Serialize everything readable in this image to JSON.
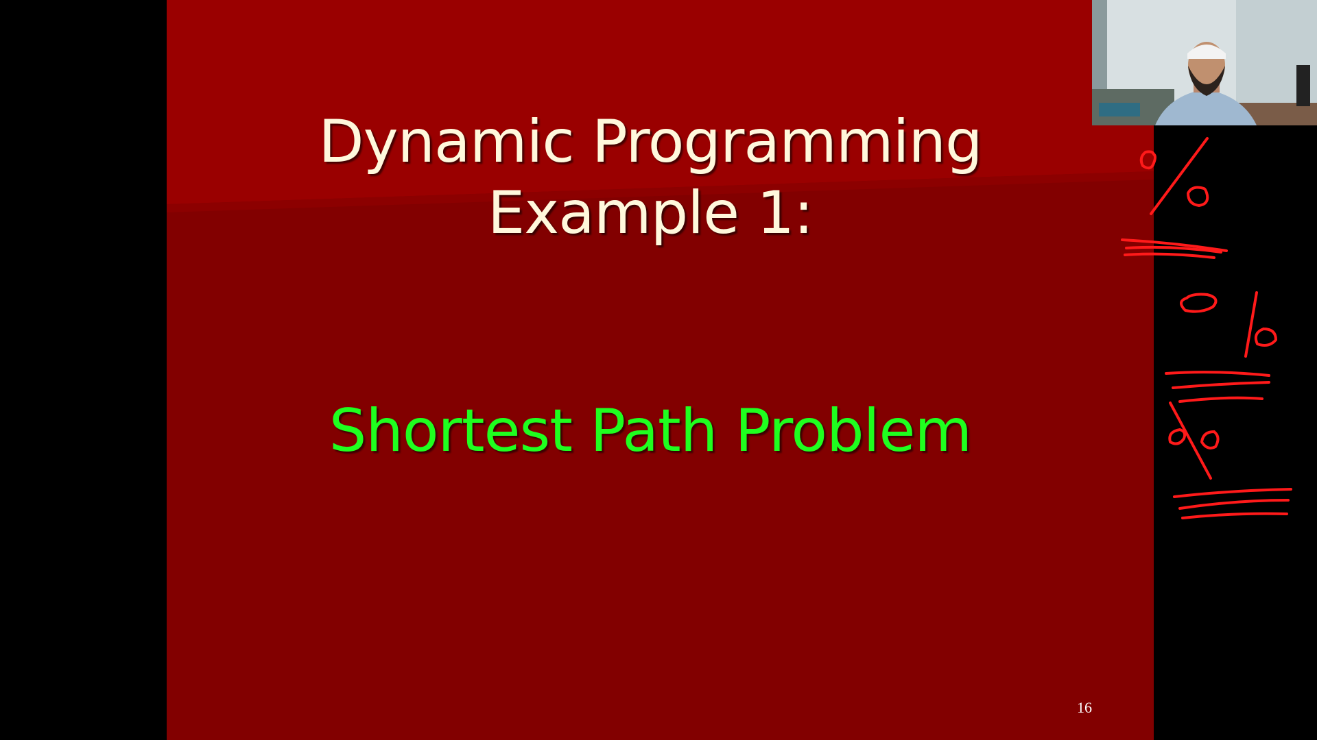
{
  "slide": {
    "title_line1": "Dynamic Programming",
    "title_line2": "Example 1:",
    "subtitle": "Shortest Path Problem",
    "page_number": "16"
  },
  "colors": {
    "slide_background": "#820000",
    "title_text": "#fff8dc",
    "subtitle_text": "#1fff1f",
    "ink": "#ff1a1a"
  }
}
